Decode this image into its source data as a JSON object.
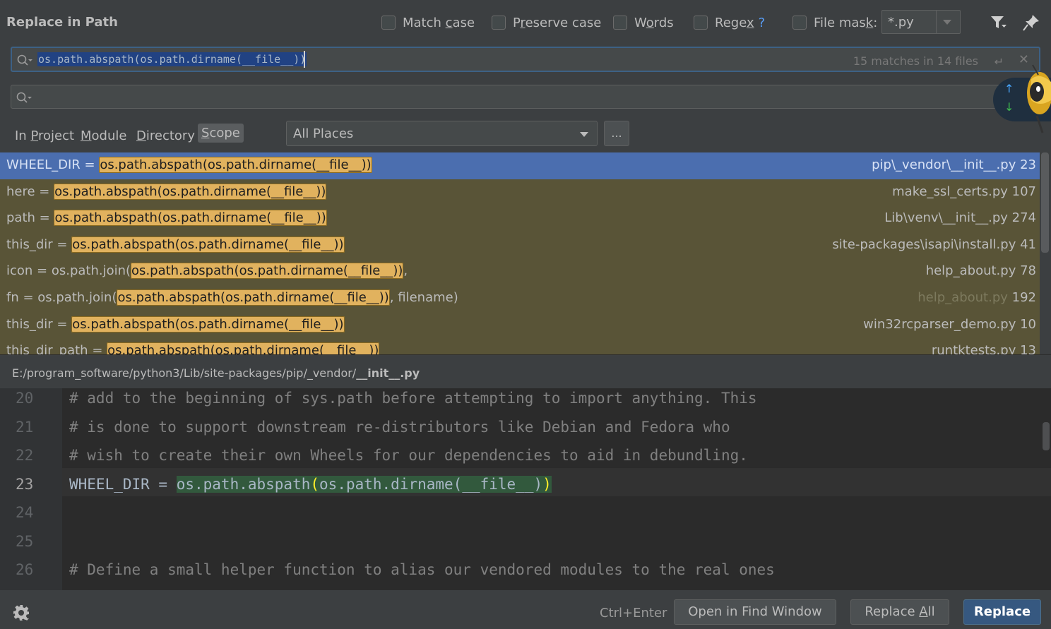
{
  "header": {
    "title": "Replace in Path",
    "options": {
      "match_case": "Match case",
      "preserve_case": "Preserve case",
      "words": "Words",
      "regex": "Regex",
      "regex_help": "?",
      "file_mask": "File mask:",
      "file_mask_value": "*.py"
    }
  },
  "search": {
    "query": "os.path.abspath(os.path.dirname(__file__))",
    "match_count": "15 matches in 14 files",
    "replace_value": ""
  },
  "scope": {
    "tabs": [
      "In Project",
      "Module",
      "Directory",
      "Scope"
    ],
    "active_tab": "Scope",
    "selected_scope": "All Places",
    "more_button": "..."
  },
  "results": [
    {
      "prefix": "WHEEL_DIR = ",
      "match": "os.path.abspath(os.path.dirname(__file__))",
      "suffix": "",
      "file": "pip\\_vendor\\__init__.py",
      "line": "23",
      "selected": true
    },
    {
      "prefix": "here = ",
      "match": "os.path.abspath(os.path.dirname(__file__))",
      "suffix": "",
      "file": "make_ssl_certs.py",
      "line": "107"
    },
    {
      "prefix": "path = ",
      "match": "os.path.abspath(os.path.dirname(__file__))",
      "suffix": "",
      "file": "Lib\\venv\\__init__.py",
      "line": "274"
    },
    {
      "prefix": "this_dir = ",
      "match": "os.path.abspath(os.path.dirname(__file__))",
      "suffix": "",
      "file": "site-packages\\isapi\\install.py",
      "line": "41"
    },
    {
      "prefix": "icon = os.path.join(",
      "match": "os.path.abspath(os.path.dirname(__file__))",
      "suffix": ",",
      "file": "help_about.py",
      "line": "78"
    },
    {
      "prefix": "fn = os.path.join(",
      "match": "os.path.abspath(os.path.dirname(__file__))",
      "suffix": ", filename)",
      "file": "help_about.py",
      "line": "192",
      "dim_file": true
    },
    {
      "prefix": "this_dir = ",
      "match": "os.path.abspath(os.path.dirname(__file__))",
      "suffix": "",
      "file": "win32rcparser_demo.py",
      "line": "10"
    },
    {
      "prefix": "this_dir_path = ",
      "match": "os.path.abspath(os.path.dirname(__file__))",
      "suffix": "",
      "file": "runtktests.py",
      "line": "13"
    }
  ],
  "preview": {
    "path_prefix": "E:/program_software/python3/Lib/site-packages/pip/_vendor/",
    "path_file": "__init__.py",
    "lines": [
      {
        "num": "20",
        "text": "# add to the beginning of sys.path before attempting to import anything. This"
      },
      {
        "num": "21",
        "text": "# is done to support downstream re-distributors like Debian and Fedora who"
      },
      {
        "num": "22",
        "text": "# wish to create their own Wheels for our dependencies to aid in debundling."
      },
      {
        "num": "23",
        "code_prefix": "WHEEL_DIR = ",
        "code_a": "os.path.abspath",
        "code_paren_open": "(",
        "code_b": "os.path.dirname(__file__)",
        "code_paren_close": ")",
        "current": true
      },
      {
        "num": "24",
        "text": ""
      },
      {
        "num": "25",
        "text": ""
      },
      {
        "num": "26",
        "text": "# Define a small helper function to alias our vendored modules to the real ones"
      }
    ]
  },
  "footer": {
    "shortcut": "Ctrl+Enter",
    "open_find_window": "Open in Find Window",
    "replace_all": "Replace All",
    "replace": "Replace"
  },
  "colors": {
    "background": "#3c3f41",
    "selection": "#4b6eaf",
    "match_highlight": "#e1b25e",
    "primary_button": "#365880"
  }
}
